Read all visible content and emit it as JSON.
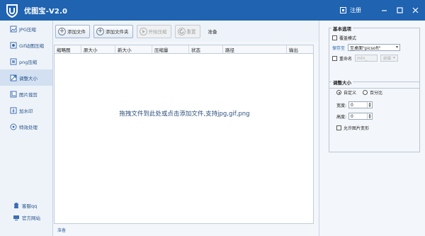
{
  "app": {
    "title": "优图宝-V2.0",
    "register_label": "注册",
    "colors": {
      "titlebar": "#1f63b1",
      "accent": "#1f63b1"
    },
    "window_controls": [
      "minimize-icon",
      "maximize-icon",
      "close-icon"
    ]
  },
  "sidebar": {
    "items": [
      {
        "label": "JPG压缩",
        "icon": "jpg-icon",
        "active": false
      },
      {
        "label": "Gif动图压缩",
        "icon": "gif-icon",
        "active": false
      },
      {
        "label": "png压缩",
        "icon": "png-icon",
        "active": false
      },
      {
        "label": "调整大小",
        "icon": "resize-icon",
        "active": true
      },
      {
        "label": "图片裁剪",
        "icon": "crop-icon",
        "active": false
      },
      {
        "label": "加水印",
        "icon": "watermark-icon",
        "active": false
      },
      {
        "label": "特效处理",
        "icon": "effects-icon",
        "active": false
      }
    ],
    "bottom": [
      {
        "label": "客服qq",
        "icon": "support-icon"
      },
      {
        "label": "官方网站",
        "icon": "website-icon"
      }
    ]
  },
  "toolbar": {
    "add_file": "添加文件",
    "add_folder": "添加文件夹",
    "start": "开始压缩",
    "reset": "重置",
    "status": "准备"
  },
  "table": {
    "columns": [
      "缩略图",
      "原大小",
      "新大小",
      "压缩量",
      "状态",
      "路径",
      "输出"
    ],
    "drop_hint": "拖拽文件到此处或点击添加文件,支持jpg,gif,png"
  },
  "statusbar": {
    "text": "准备"
  },
  "panel": {
    "basic": {
      "title": "基本选项",
      "overwrite_label": "覆盖模式",
      "save_to_label": "保存至",
      "save_to_value": "至桌面\"picsoft\"",
      "rename_label": "重命名",
      "rename_value": "min_",
      "rename_mode": "前缀"
    },
    "resize": {
      "title": "调整大小",
      "custom_label": "自定义",
      "percent_label": "百分比",
      "width_label": "宽度:",
      "width_value": "0",
      "height_label": "高度:",
      "height_value": "0",
      "allow_deform_label": "允许图片变形"
    }
  }
}
